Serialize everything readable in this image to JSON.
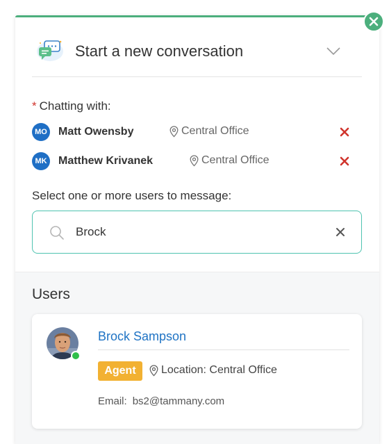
{
  "header": {
    "title": "Start a new conversation",
    "icon": "chat-bubbles-icon",
    "chevron_icon": "chevron-down-icon",
    "close_icon": "close-icon"
  },
  "chatting": {
    "required_mark": "*",
    "label": "Chatting with:",
    "participants": [
      {
        "initials": "MO",
        "name": "Matt Owensby",
        "location": "Central Office"
      },
      {
        "initials": "MK",
        "name": "Matthew Krivanek",
        "location": "Central Office"
      }
    ]
  },
  "search": {
    "label": "Select one or more users to message:",
    "value": "Brock",
    "placeholder": ""
  },
  "users": {
    "heading": "Users",
    "results": [
      {
        "name": "Brock Sampson",
        "role": "Agent",
        "location": "Location: Central Office",
        "email_label": "Email:",
        "email": "bs2@tammany.com",
        "online": true
      }
    ]
  },
  "colors": {
    "accent": "#4caf7d",
    "link": "#1f73c4",
    "badge": "#f2b132",
    "remove": "#d0342c",
    "avatar": "#1f6fc5",
    "search_border": "#4ec3b0"
  }
}
